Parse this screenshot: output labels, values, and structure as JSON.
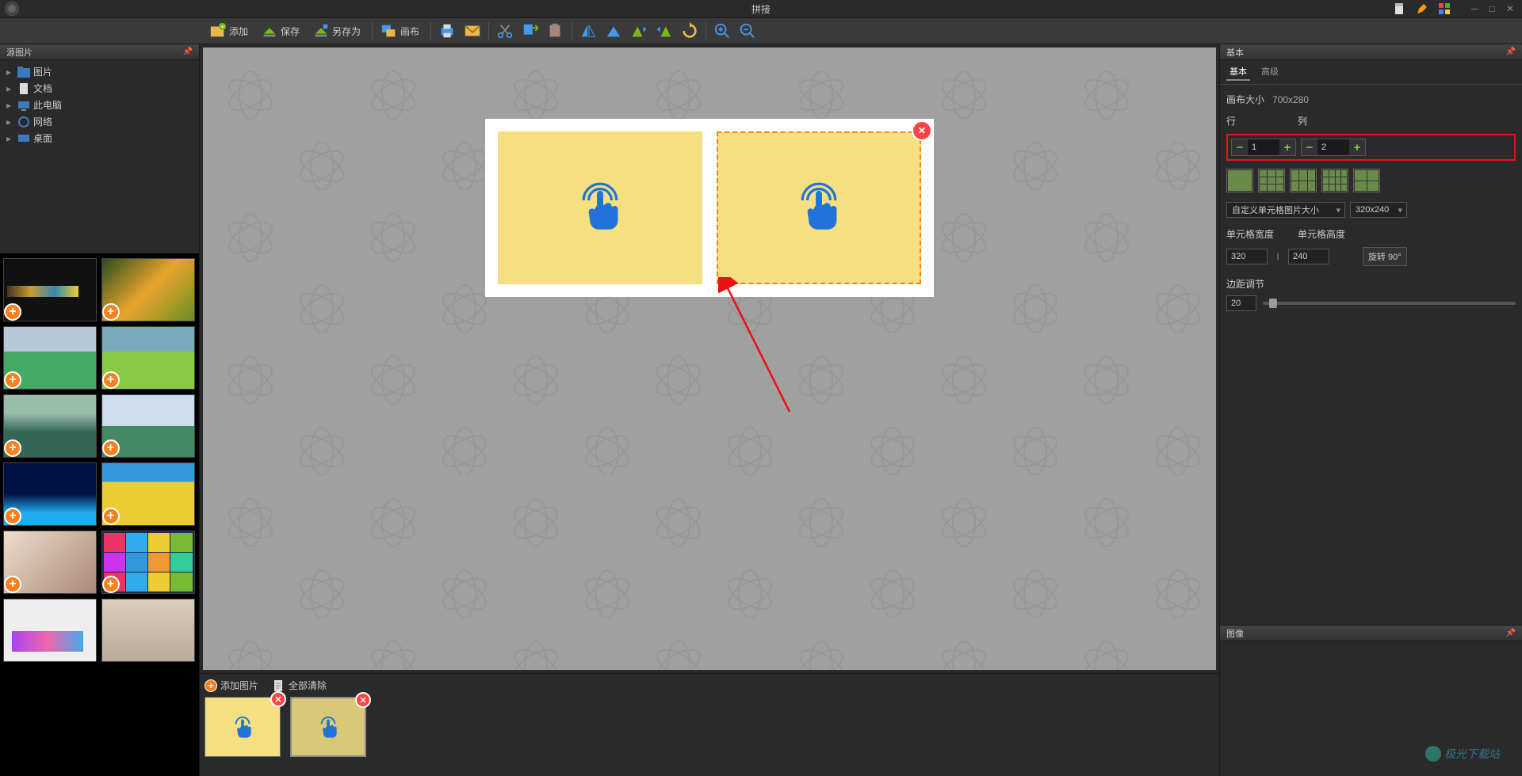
{
  "window": {
    "title": "拼接"
  },
  "left_panel": {
    "title": "源图片",
    "folders": [
      {
        "label": "图片"
      },
      {
        "label": "文档"
      },
      {
        "label": "此电脑"
      },
      {
        "label": "网络"
      },
      {
        "label": "桌面"
      }
    ]
  },
  "toolbar": {
    "add": "添加",
    "save": "保存",
    "saveas": "另存为",
    "canvas": "画布"
  },
  "bottom": {
    "add_image": "添加图片",
    "clear_all": "全部清除"
  },
  "right_panel": {
    "basic_header": "基本",
    "image_header": "图像",
    "tabs": {
      "basic": "基本",
      "advanced": "高级"
    },
    "canvas_size_label": "画布大小",
    "canvas_size_value": "700x280",
    "rows_label": "行",
    "cols_label": "列",
    "rows_value": "1",
    "cols_value": "2",
    "cell_mode_label": "自定义单元格图片大小",
    "cell_preset": "320x240",
    "cell_w_label": "单元格宽度",
    "cell_h_label": "单元格高度",
    "cell_w": "320",
    "cell_h": "240",
    "link_char": "I",
    "rotate_label": "旋转 90°",
    "margin_label": "边距调节",
    "margin_value": "20"
  }
}
